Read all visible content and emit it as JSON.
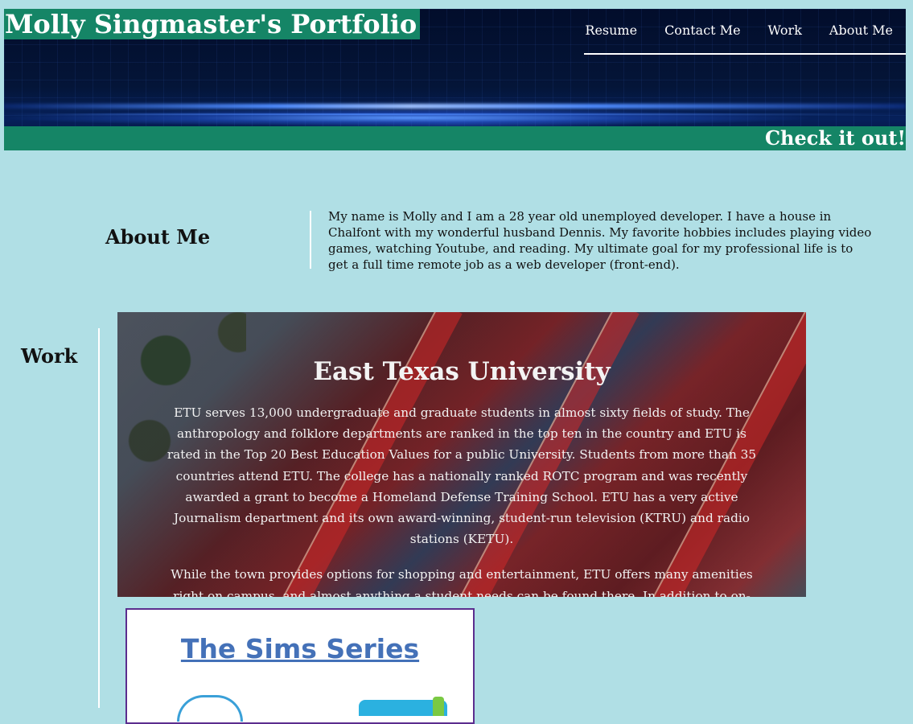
{
  "header": {
    "site_title": "Molly Singmaster's Portfolio",
    "nav": [
      "Resume",
      "Contact Me",
      "Work",
      "About Me"
    ],
    "banner_text": "Check it out!"
  },
  "about": {
    "heading": "About Me",
    "text": "My name is Molly and I am a 28 year old unemployed developer. I have a house in Chalfont with my wonderful husband Dennis. My favorite hobbies includes playing video games, watching Youtube, and reading. My ultimate goal for my professional life is to get a full time remote job as a web developer (front-end)."
  },
  "work": {
    "heading": "Work",
    "projects": [
      {
        "title": "East Texas University",
        "paragraphs": [
          "ETU serves 13,000 undergraduate and graduate students in almost sixty fields of study. The anthropology and folklore departments are ranked in the top ten in the country and ETU is rated in the Top 20 Best Education Values for a public University. Students from more than 35 countries attend ETU. The college has a nationally ranked ROTC program and was recently awarded a grant to become a Homeland Defense Training School. ETU has a very active Journalism department and its own award-winning, student-run television (KTRU) and radio stations (KETU).",
          "While the town provides options for shopping and entertainment, ETU offers many amenities right on campus, and almost anything a student needs can be found there. In addition to on-campus housing"
        ]
      },
      {
        "title": "The Sims Series"
      }
    ]
  },
  "colors": {
    "page_background": "#b0dfe5",
    "accent_green": "#158566",
    "sims_border": "#5b2d8e",
    "sims_link": "#4471b8"
  }
}
